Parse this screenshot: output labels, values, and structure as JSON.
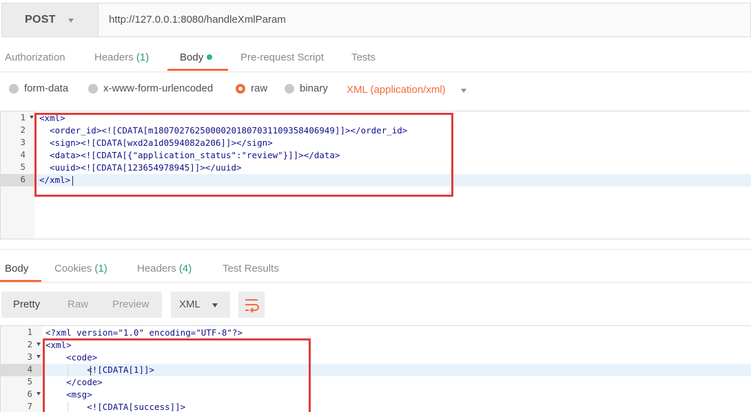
{
  "request": {
    "method": "POST",
    "url": "http://127.0.0.1:8080/handleXmlParam"
  },
  "request_tabs": [
    {
      "label": "Authorization"
    },
    {
      "label": "Headers",
      "count": "(1)"
    },
    {
      "label": "Body"
    },
    {
      "label": "Pre-request Script"
    },
    {
      "label": "Tests"
    }
  ],
  "body_types": {
    "options": [
      "form-data",
      "x-www-form-urlencoded",
      "raw",
      "binary"
    ],
    "selected": "raw",
    "content_type": "XML (application/xml)"
  },
  "request_body": {
    "line_numbers": [
      "1",
      "2",
      "3",
      "4",
      "5",
      "6"
    ],
    "lines": [
      "<xml>",
      "  <order_id><![CDATA[m1807027625000020180703110935840694 9]]></order_id>",
      "  <sign><![CDATA[wxd2a1d0594082a206]]></sign>",
      "  <data><![CDATA[{\"application_status\":\"review\"}]]></data>",
      "  <uuid><![CDATA[123654978945]]></uuid>",
      "</xml>"
    ]
  },
  "response_tabs": [
    {
      "label": "Body"
    },
    {
      "label": "Cookies",
      "count": "(1)"
    },
    {
      "label": "Headers",
      "count": "(4)"
    },
    {
      "label": "Test Results"
    }
  ],
  "response_toolbar": {
    "views": [
      "Pretty",
      "Raw",
      "Preview"
    ],
    "format": "XML"
  },
  "response_body": {
    "line_numbers": [
      "1",
      "2",
      "3",
      "4",
      "5",
      "6",
      "7"
    ],
    "lines": [
      "<?xml version=\"1.0\" encoding=\"UTF-8\"?>",
      "<xml>",
      "    <code>",
      "        <![CDATA[1]]>",
      "    </code>",
      "    <msg>",
      "        <![CDATA[success]]>"
    ]
  },
  "colors": {
    "accent": "#f26b3a",
    "count_green": "#2c9d6a",
    "body_dot": "#2db77b",
    "highlight_box": "#e03c3c"
  },
  "icons": [
    "chevron-down-icon",
    "wrap-lines-icon",
    "fold-arrow-icon"
  ]
}
